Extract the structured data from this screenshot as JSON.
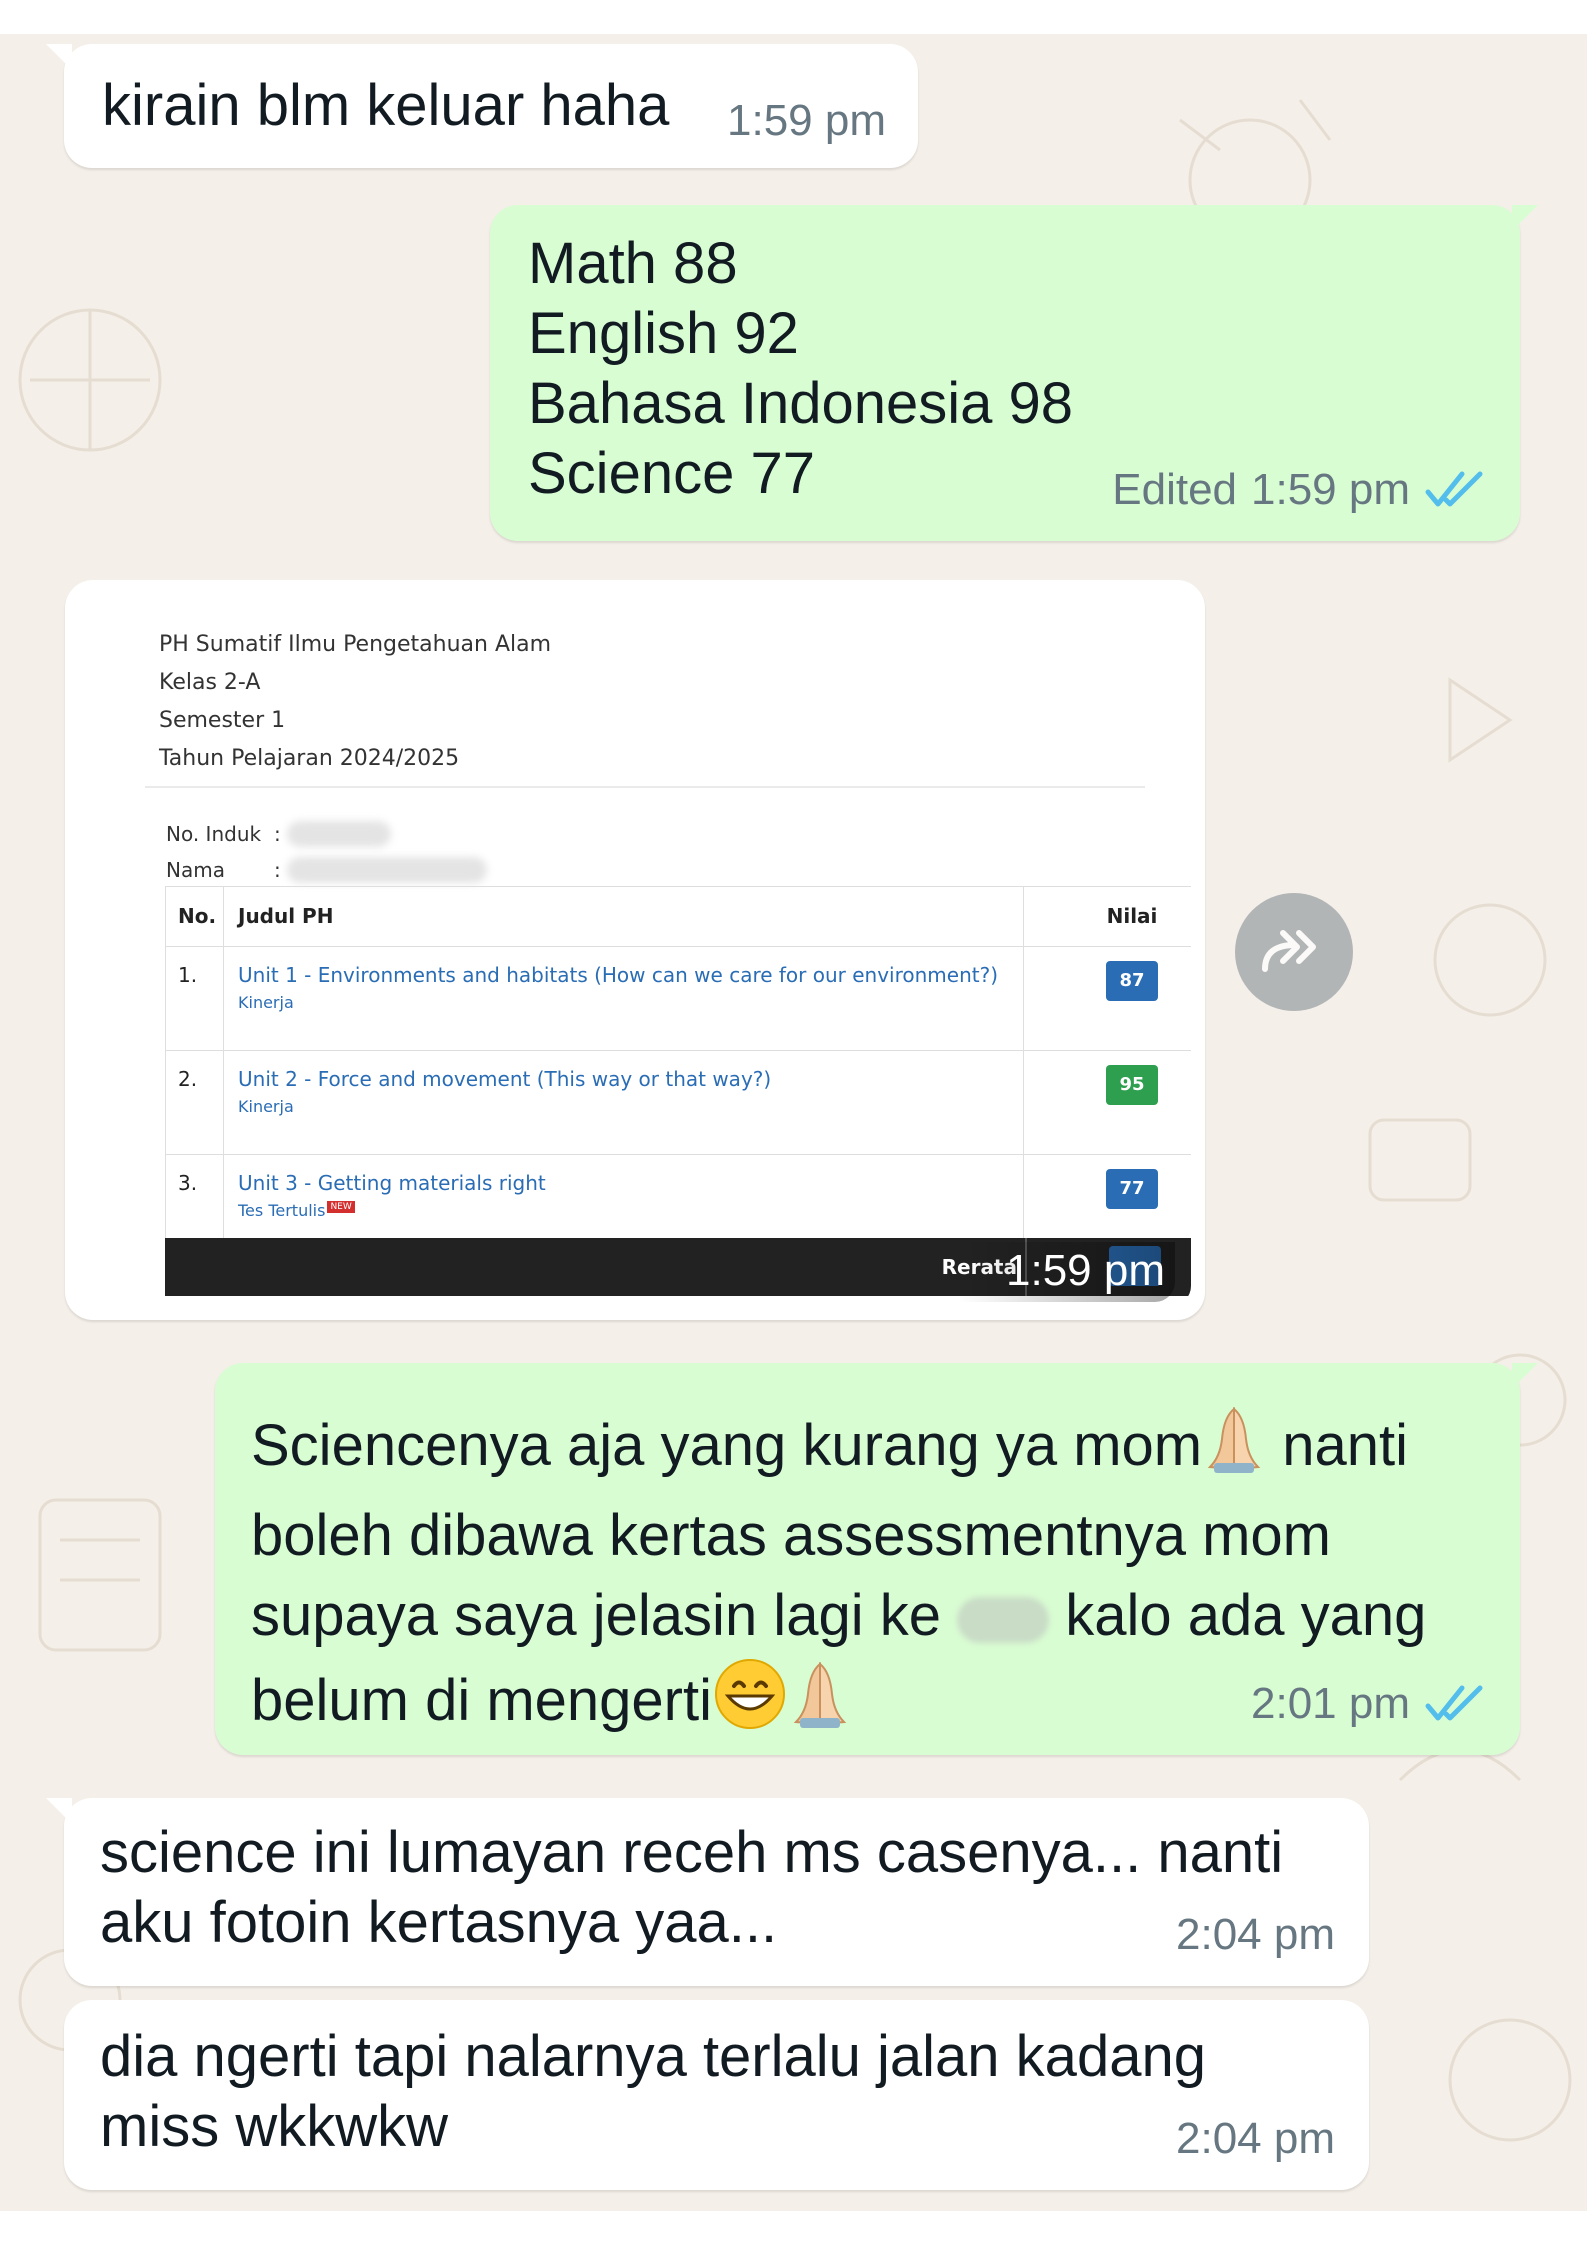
{
  "messages": [
    {
      "text": "kirain blm keluar haha",
      "time": "1:59 pm"
    },
    {
      "lines": [
        "Math 88",
        "English 92",
        "Bahasa Indonesia 98",
        "Science 77"
      ],
      "edited_label": "Edited",
      "time": "1:59 pm"
    },
    {
      "seg1": "Sciencenya aja yang kurang ya mom",
      "seg2": " nanti\nboleh dibawa kertas assessmentnya mom\nsupaya saya jelasin lagi ke ",
      "seg3": " kalo ada yang\nbelum di mengerti",
      "time": "2:01 pm"
    },
    {
      "text": "science ini lumayan receh ms casenya... nanti\naku fotoin kertasnya yaa...",
      "time": "2:04 pm"
    },
    {
      "text": "dia ngerti tapi nalarnya terlalu jalan kadang\nmiss wkkwkw",
      "time": "2:04 pm"
    }
  ],
  "image_message": {
    "time": "1:59 pm",
    "header_lines": [
      "PH Sumatif Ilmu Pengetahuan Alam",
      "Kelas 2-A",
      "Semester 1",
      "Tahun Pelajaran 2024/2025"
    ],
    "fields": {
      "no_induk_label": "No. Induk",
      "nama_label": "Nama",
      "colon": ":"
    },
    "table": {
      "headers": [
        "No.",
        "Judul PH",
        "Nilai"
      ],
      "rows": [
        {
          "no": "1.",
          "title": "Unit 1 - Environments and habitats (How can we care for our environment?)",
          "type": "Kinerja",
          "value": "87",
          "color": "#2a6db5"
        },
        {
          "no": "2.",
          "title": "Unit 2 - Force and movement (This way or that way?)",
          "type": "Kinerja",
          "value": "95",
          "color": "#2e9e4f"
        },
        {
          "no": "3.",
          "title": "Unit 3 - Getting materials right",
          "type": "Tes Tertulis",
          "new_label": "NEW",
          "value": "77",
          "color": "#2a6db5"
        }
      ],
      "footer_label": "Rerata"
    }
  },
  "colors": {
    "outgoing": "#d9fdd3",
    "incoming": "#ffffff",
    "ticks": "#53bdeb",
    "background": "#f4efe8"
  },
  "icons": {
    "read_receipt": "double-check-icon",
    "forward": "forward-icon",
    "praying_hands": "folded-hands-emoji",
    "grin": "grinning-face-emoji"
  }
}
